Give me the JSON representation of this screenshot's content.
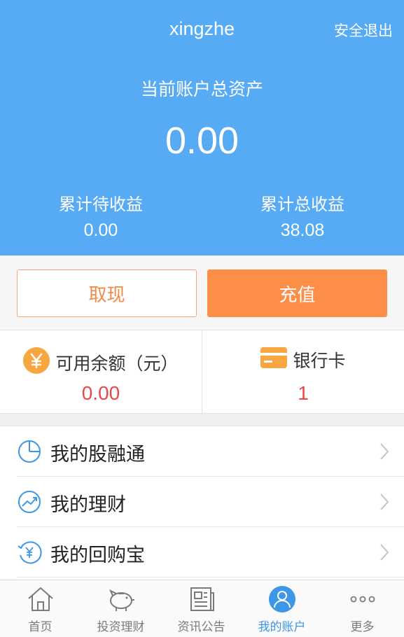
{
  "header": {
    "username": "xingzhe",
    "logout_label": "安全退出",
    "total_assets_label": "当前账户总资产",
    "total_assets_value": "0.00",
    "pending_income_label": "累计待收益",
    "pending_income_value": "0.00",
    "total_income_label": "累计总收益",
    "total_income_value": "38.08",
    "background_color": "#56abf4"
  },
  "actions": {
    "withdraw_label": "取现",
    "recharge_label": "充值",
    "recharge_color": "#fd8e48"
  },
  "balance": {
    "available_label": "可用余额（元）",
    "available_value": "0.00",
    "available_icon": "yuan-coin-icon",
    "bank_card_label": "银行卡",
    "bank_card_value": "1",
    "bank_card_icon": "bank-card-icon"
  },
  "menu": {
    "items": [
      {
        "label": "我的股融通",
        "icon": "pie-chart-icon"
      },
      {
        "label": "我的理财",
        "icon": "trend-chart-icon"
      },
      {
        "label": "我的回购宝",
        "icon": "yuan-refresh-icon"
      }
    ]
  },
  "tabbar": {
    "items": [
      {
        "label": "首页",
        "icon": "home-icon",
        "active": false
      },
      {
        "label": "投资理财",
        "icon": "piggy-bank-icon",
        "active": false
      },
      {
        "label": "资讯公告",
        "icon": "newspaper-icon",
        "active": false
      },
      {
        "label": "我的账户",
        "icon": "user-icon",
        "active": true
      },
      {
        "label": "更多",
        "icon": "more-icon",
        "active": false
      }
    ],
    "active_color": "#3d97e6"
  }
}
